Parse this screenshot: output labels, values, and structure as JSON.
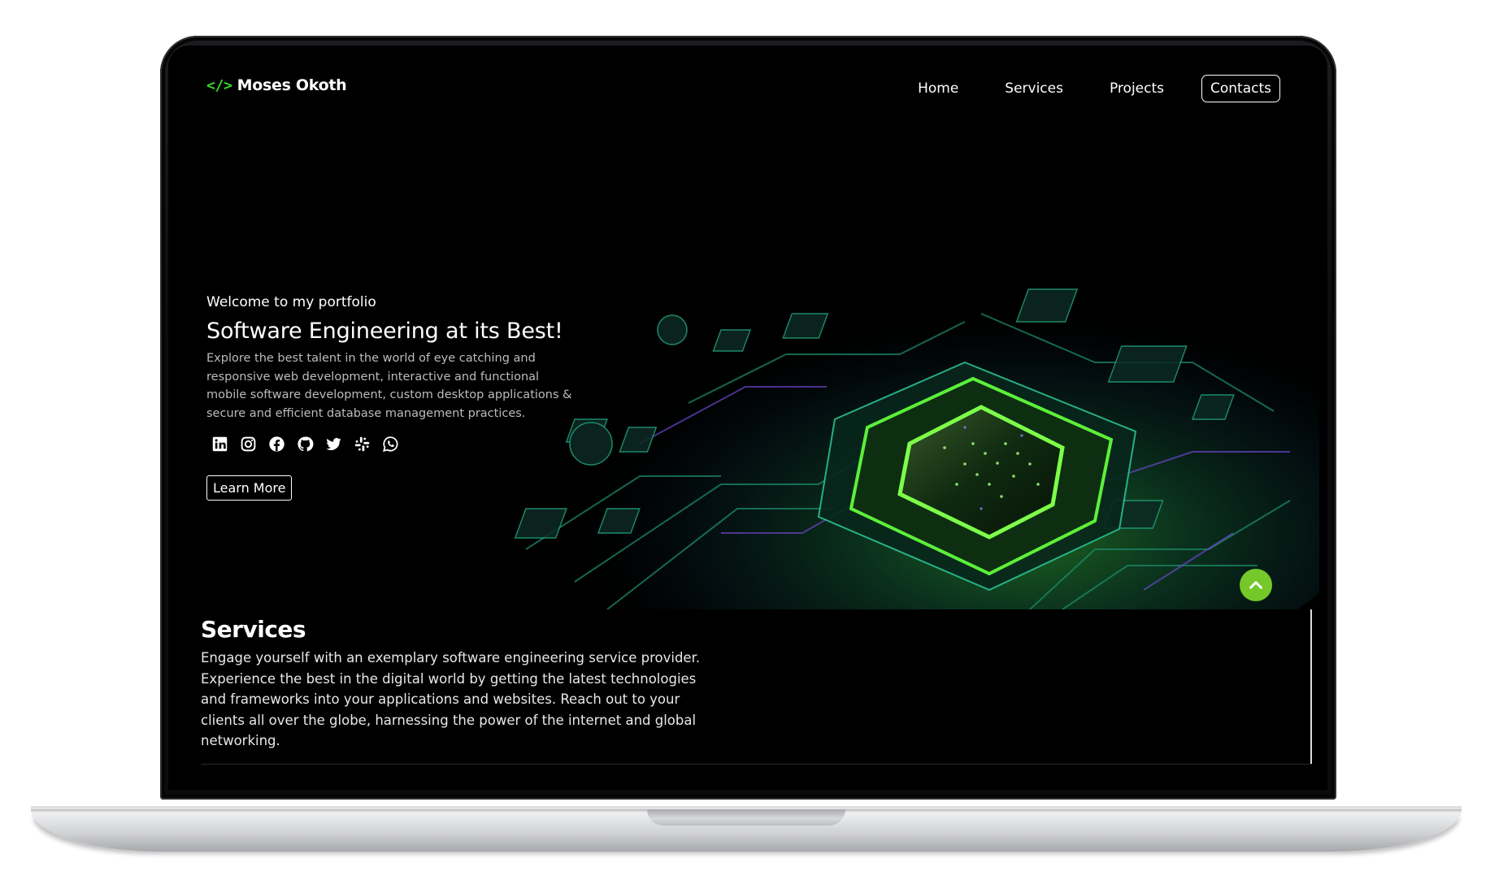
{
  "header": {
    "brand_icon": "</>",
    "brand_name": "Moses Okoth",
    "nav": [
      "Home",
      "Services",
      "Projects"
    ],
    "contact_label": "Contacts"
  },
  "hero": {
    "welcome": "Welcome to my portfolio",
    "title": "Software Engineering at its Best!",
    "description": "Explore the best talent in the world of eye catching and responsive web development, interactive and functional mobile software development, custom desktop applications & secure and efficient database management practices.",
    "social_icons": [
      "linkedin-icon",
      "instagram-icon",
      "facebook-icon",
      "github-icon",
      "twitter-icon",
      "slack-icon",
      "whatsapp-icon"
    ],
    "cta_label": "Learn More"
  },
  "services": {
    "title": "Services",
    "description": "Engage yourself with an exemplary software engineering service provider. Experience the best in the digital world by getting the latest technologies and frameworks into your applications and websites. Reach out to your clients all over the globe, harnessing the power of the internet and global networking."
  },
  "colors": {
    "accent_green": "#39d92c",
    "scroll_button": "#74c82a",
    "background": "#000000"
  }
}
